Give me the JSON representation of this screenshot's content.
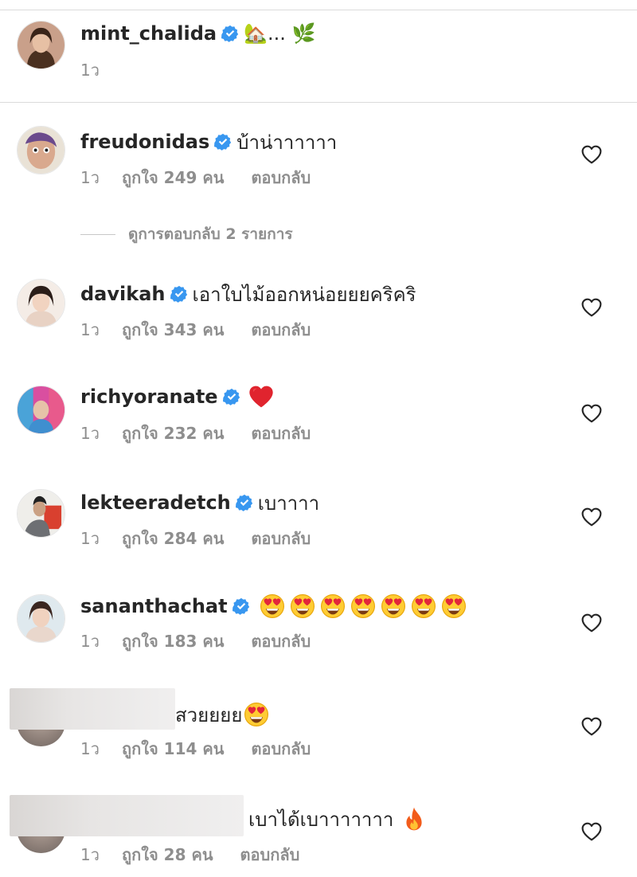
{
  "caption": {
    "username": "mint_chalida",
    "text": "🏡... 🌿",
    "time": "1ว"
  },
  "view_replies": "ดูการตอบกลับ 2 รายการ",
  "comments": [
    {
      "username": "freudonidas",
      "text": "บ้าน่าาาาาา",
      "time": "1ว",
      "likes": "ถูกใจ 249 คน",
      "reply": "ตอบกลับ"
    },
    {
      "username": "davikah",
      "text": "เอาใบไม้ออกหน่อยยยคริคริ",
      "time": "1ว",
      "likes": "ถูกใจ 343 คน",
      "reply": "ตอบกลับ"
    },
    {
      "username": "richyoranate",
      "text": "",
      "time": "1ว",
      "likes": "ถูกใจ 232 คน",
      "reply": "ตอบกลับ"
    },
    {
      "username": "lekteeradetch",
      "text": "เบาาาา",
      "time": "1ว",
      "likes": "ถูกใจ 284 คน",
      "reply": "ตอบกลับ"
    },
    {
      "username": "sananthachat",
      "text": "",
      "time": "1ว",
      "likes": "ถูกใจ 183 คน",
      "reply": "ตอบกลับ"
    },
    {
      "username": "",
      "text": "สวยยยย",
      "time": "1ว",
      "likes": "ถูกใจ 114 คน",
      "reply": "ตอบกลับ"
    },
    {
      "username": "",
      "text": "เบาได้เบาาาาาาา",
      "time": "1ว",
      "likes": "ถูกใจ 28 คน",
      "reply": "ตอบกลับ"
    }
  ],
  "icons": {
    "verified": "verified-badge-icon",
    "like": "heart-outline-icon"
  },
  "colors": {
    "text": "#262626",
    "meta": "#8e8e8e",
    "verified": "#3897f0",
    "divider": "#dbdbdb"
  }
}
